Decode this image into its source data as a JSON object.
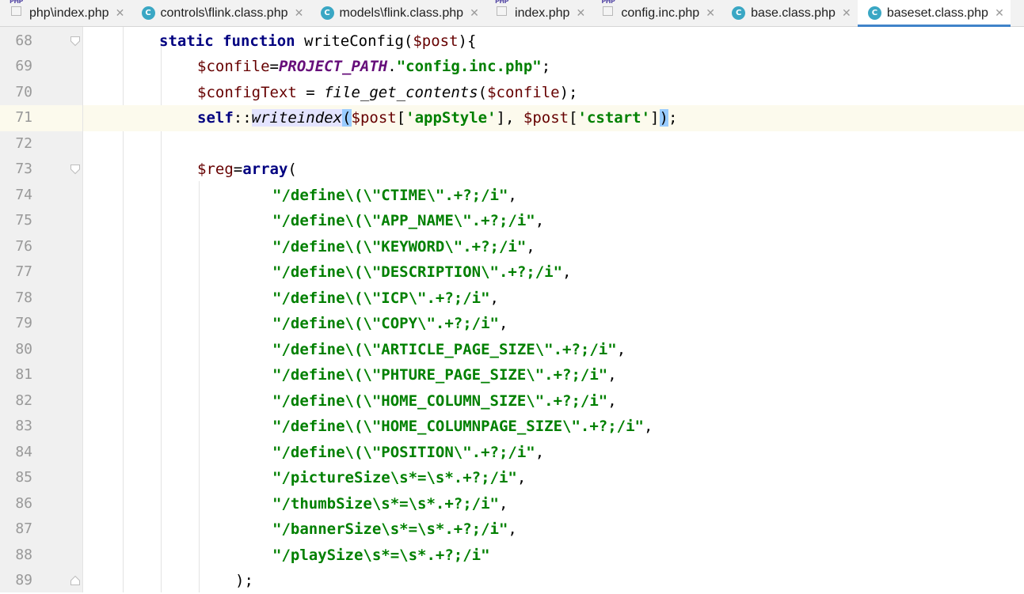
{
  "tabs": [
    {
      "label": "php\\index.php",
      "icon": "php-file-icon",
      "active": false
    },
    {
      "label": "controls\\flink.class.php",
      "icon": "class-file-icon",
      "active": false
    },
    {
      "label": "models\\flink.class.php",
      "icon": "class-file-icon",
      "active": false
    },
    {
      "label": "index.php",
      "icon": "php-file-icon",
      "active": false
    },
    {
      "label": "config.inc.php",
      "icon": "php-file-icon",
      "active": false
    },
    {
      "label": "base.class.php",
      "icon": "class-file-icon",
      "active": false
    },
    {
      "label": "baseset.class.php",
      "icon": "class-file-icon",
      "active": true
    }
  ],
  "icons": {
    "php_text": "PHP",
    "class_letter": "C",
    "close": "✕"
  },
  "colors": {
    "accent": "#4083c9",
    "current_line": "#fcfaed",
    "keyword": "#000080",
    "string": "#008000",
    "variable": "#660000",
    "constant": "#660e7a"
  },
  "editor": {
    "current_line": 71,
    "lines": [
      {
        "num": "68",
        "code": "static function writeConfig($post){"
      },
      {
        "num": "69",
        "code": "$confile=PROJECT_PATH.\"config.inc.php\";"
      },
      {
        "num": "70",
        "code": "$configText = file_get_contents($confile);"
      },
      {
        "num": "71",
        "code": "self::writeindex($post['appStyle'], $post['cstart']);"
      },
      {
        "num": "72",
        "code": ""
      },
      {
        "num": "73",
        "code": "$reg=array("
      },
      {
        "num": "74",
        "code": "\"/define\\(\\\"CTIME\\\".+?;/i\","
      },
      {
        "num": "75",
        "code": "\"/define\\(\\\"APP_NAME\\\".+?;/i\","
      },
      {
        "num": "76",
        "code": "\"/define\\(\\\"KEYWORD\\\".+?;/i\","
      },
      {
        "num": "77",
        "code": "\"/define\\(\\\"DESCRIPTION\\\".+?;/i\","
      },
      {
        "num": "78",
        "code": "\"/define\\(\\\"ICP\\\".+?;/i\","
      },
      {
        "num": "79",
        "code": "\"/define\\(\\\"COPY\\\".+?;/i\","
      },
      {
        "num": "80",
        "code": "\"/define\\(\\\"ARTICLE_PAGE_SIZE\\\".+?;/i\","
      },
      {
        "num": "81",
        "code": "\"/define\\(\\\"PHTURE_PAGE_SIZE\\\".+?;/i\","
      },
      {
        "num": "82",
        "code": "\"/define\\(\\\"HOME_COLUMN_SIZE\\\".+?;/i\","
      },
      {
        "num": "83",
        "code": "\"/define\\(\\\"HOME_COLUMNPAGE_SIZE\\\".+?;/i\","
      },
      {
        "num": "84",
        "code": "\"/define\\(\\\"POSITION\\\".+?;/i\","
      },
      {
        "num": "85",
        "code": "\"/pictureSize\\s*=\\s*.+?;/i\","
      },
      {
        "num": "86",
        "code": "\"/thumbSize\\s*=\\s*.+?;/i\","
      },
      {
        "num": "87",
        "code": "\"/bannerSize\\s*=\\s*.+?;/i\","
      },
      {
        "num": "88",
        "code": "\"/playSize\\s*=\\s*.+?;/i\""
      },
      {
        "num": "89",
        "code": ");"
      }
    ]
  }
}
